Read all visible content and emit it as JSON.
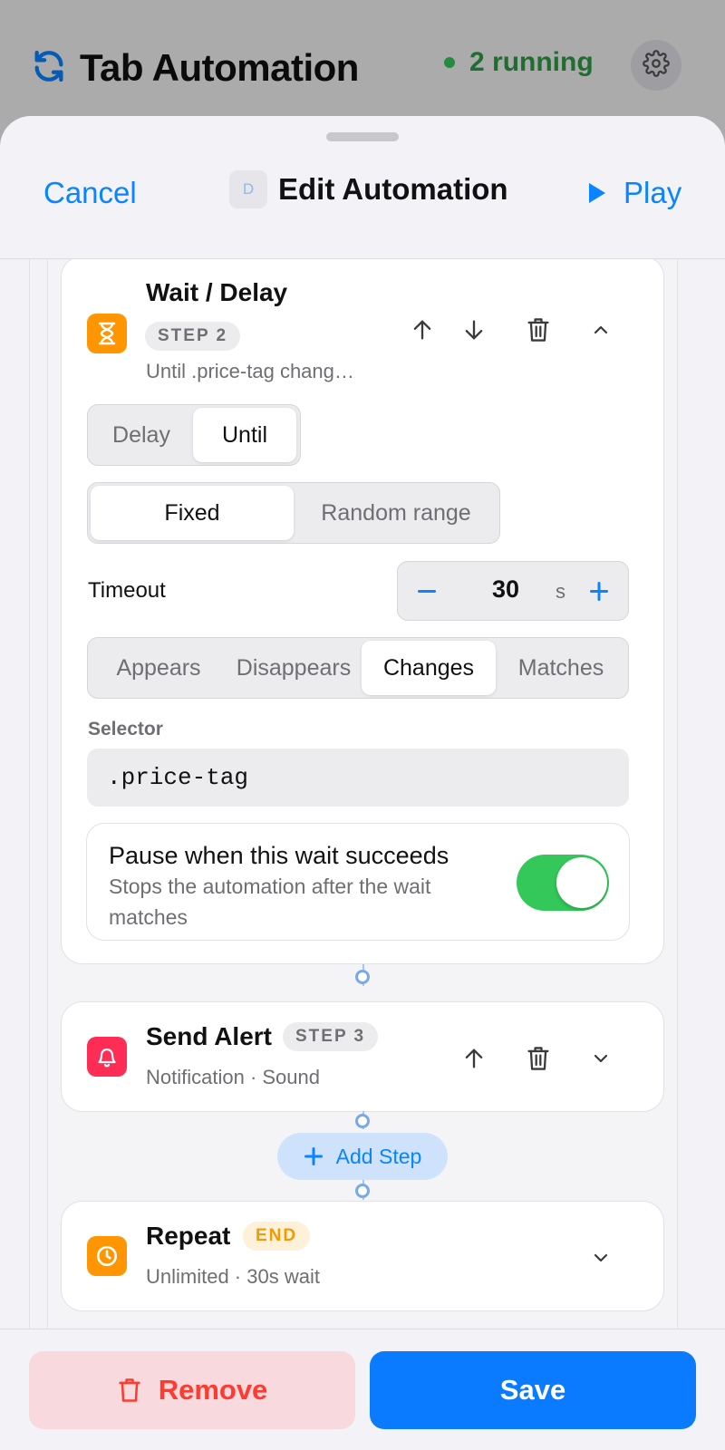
{
  "background": {
    "app_title": "Tab Automation",
    "running_status": "2 running",
    "refresh_icon": "refresh-icon",
    "settings_icon": "gear-icon"
  },
  "sheet": {
    "cancel_label": "Cancel",
    "badge_letter": "D",
    "title": "Edit Automation",
    "play_label": "Play"
  },
  "step2": {
    "title": "Wait / Delay",
    "step_label": "STEP 2",
    "summary": "Until .price-tag chang…",
    "icon": "hourglass-icon",
    "icon_color": "#ff9500",
    "mode_options": [
      "Delay",
      "Until"
    ],
    "mode_selected": "Until",
    "timing_options": [
      "Fixed",
      "Random range"
    ],
    "timing_selected": "Fixed",
    "timeout_label": "Timeout",
    "timeout_value": "30",
    "timeout_unit": "s",
    "condition_options": [
      "Appears",
      "Disappears",
      "Changes",
      "Matches"
    ],
    "condition_selected": "Changes",
    "selector_label": "Selector",
    "selector_value": ".price-tag",
    "pause_title": "Pause when this wait succeeds",
    "pause_desc_line1": "Stops the automation after the wait",
    "pause_desc_line2": "matches",
    "pause_enabled": true
  },
  "step3": {
    "title": "Send Alert",
    "step_label": "STEP 3",
    "summary": "Notification · Sound",
    "icon": "bell-icon",
    "icon_color": "#ff2d55"
  },
  "add_step_label": "Add Step",
  "end_step": {
    "title": "Repeat",
    "step_label": "END",
    "summary": "Unlimited · 30s wait",
    "icon": "clock-icon",
    "icon_color": "#ff9500"
  },
  "footer": {
    "remove_label": "Remove",
    "save_label": "Save"
  },
  "colors": {
    "accent": "#0a84ff",
    "success": "#34c759",
    "danger": "#ff3b30"
  }
}
